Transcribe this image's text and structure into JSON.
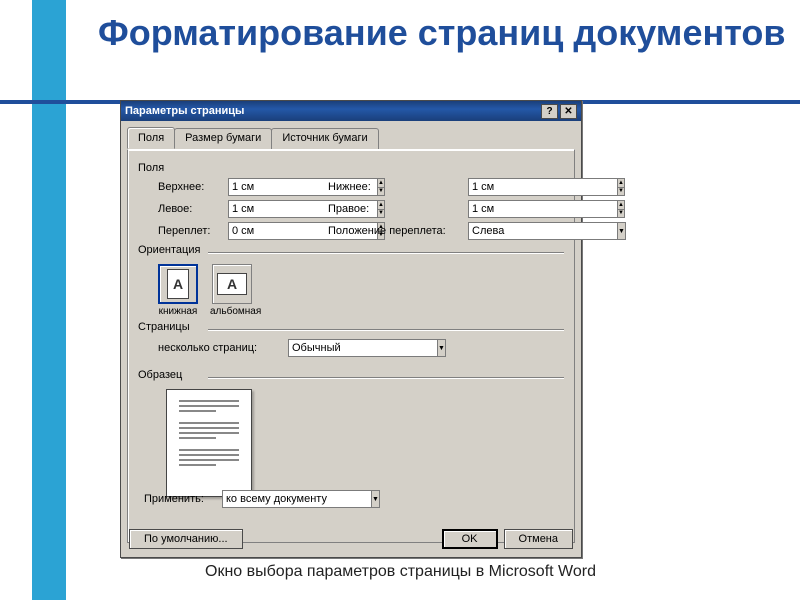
{
  "slide": {
    "title": "Форматирование страниц документов",
    "caption": "Окно выбора параметров страницы в Microsoft Word"
  },
  "dialog": {
    "title": "Параметры страницы",
    "tabs": {
      "fields": "Поля",
      "paper_size": "Размер бумаги",
      "paper_source": "Источник бумаги"
    },
    "groups": {
      "fields": "Поля",
      "orientation": "Ориентация",
      "pages": "Страницы",
      "sample": "Образец"
    },
    "labels": {
      "top": "Верхнее:",
      "bottom": "Нижнее:",
      "left": "Левое:",
      "right": "Правое:",
      "gutter": "Переплет:",
      "gutter_pos": "Положение переплета:",
      "multi_pages": "несколько страниц:",
      "apply_to": "Применить:",
      "portrait": "книжная",
      "landscape": "альбомная",
      "default_btn": "По умолчанию...",
      "ok": "OK",
      "cancel": "Отмена"
    },
    "values": {
      "top": "1 см",
      "bottom": "1 см",
      "left": "1 см",
      "right": "1 см",
      "gutter": "0 см",
      "gutter_pos": "Слева",
      "multi_pages": "Обычный",
      "apply_to": "ко всему документу"
    }
  }
}
